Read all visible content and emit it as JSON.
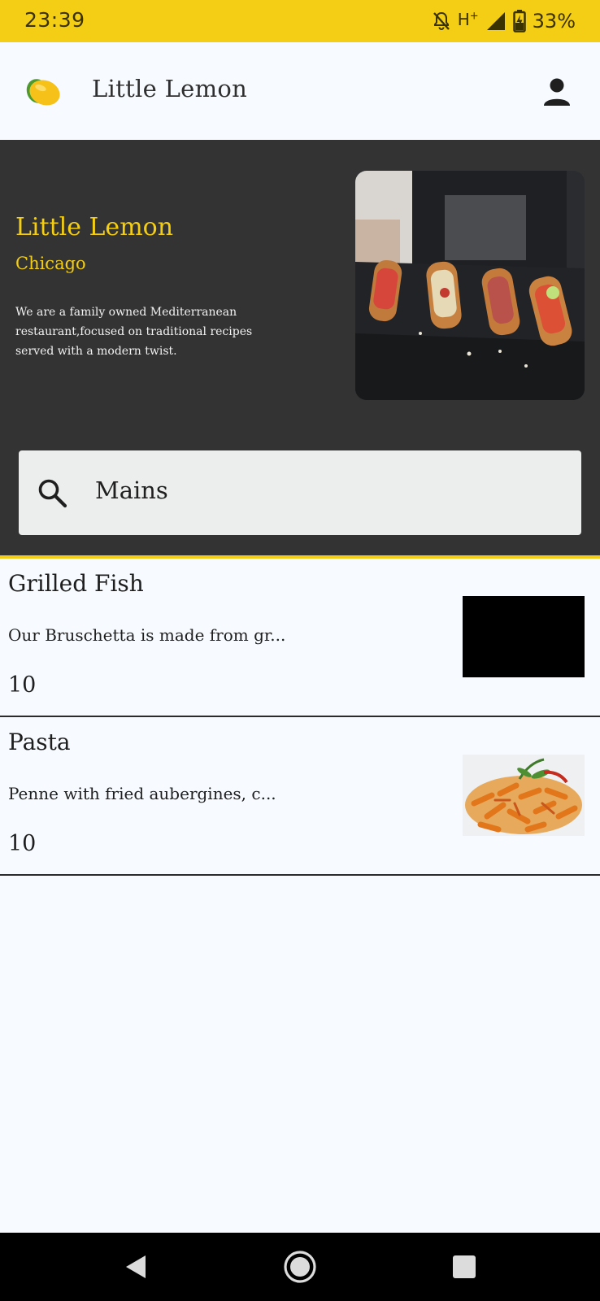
{
  "status_bar": {
    "time": "23:39",
    "network": "H",
    "network_sup": "+",
    "battery": "33%"
  },
  "app_bar": {
    "title": "Little Lemon",
    "logo_icon": "lemon-icon",
    "profile_icon": "person-icon"
  },
  "hero": {
    "title": "Little Lemon",
    "subtitle": "Chicago",
    "description": "We are a family owned Mediterranean restaurant,focused on traditional recipes served with a modern twist."
  },
  "search": {
    "value": "Mains",
    "icon": "search-icon"
  },
  "menu": [
    {
      "name": "Grilled Fish",
      "description": "Our Bruschetta is made from gr...",
      "price": "10",
      "image": "black-placeholder"
    },
    {
      "name": "Pasta",
      "description": "Penne with fried aubergines, c...",
      "price": "10",
      "image": "pasta-photo"
    }
  ],
  "colors": {
    "accent_yellow": "#F4CE14",
    "hero_bg": "#333333",
    "page_bg": "#F7FBFF"
  },
  "nav_bar": {
    "icons": [
      "back-icon",
      "home-icon",
      "recents-icon"
    ]
  }
}
